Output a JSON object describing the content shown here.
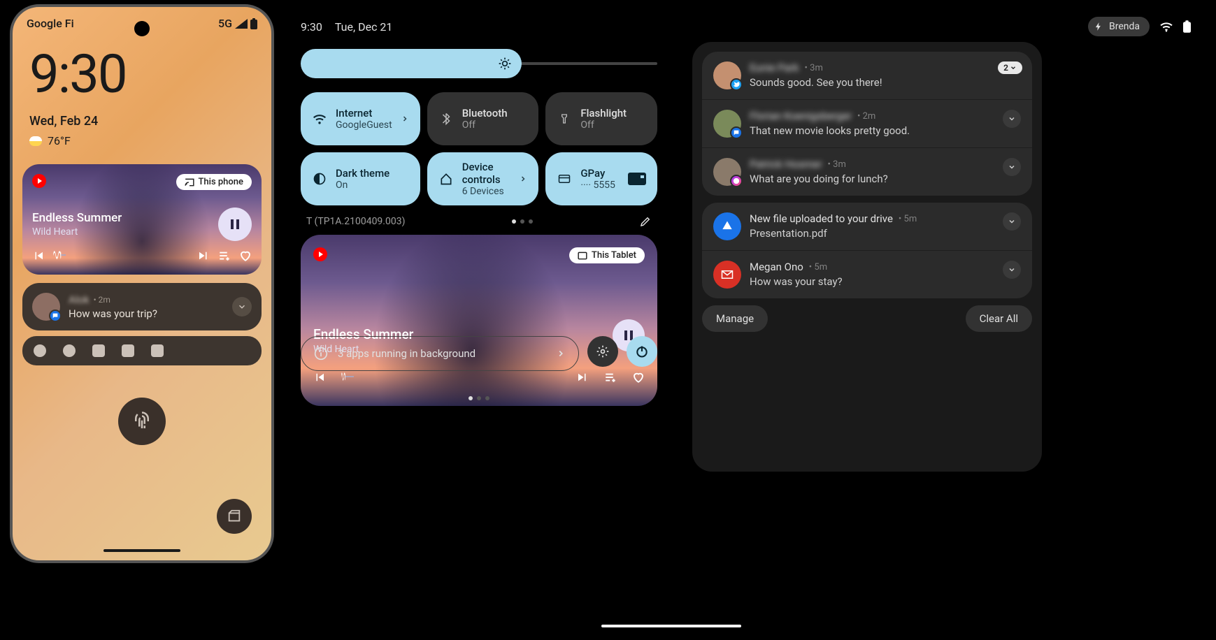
{
  "phone": {
    "carrier": "Google Fi",
    "network": "5G",
    "time": "9:30",
    "date": "Wed, Feb 24",
    "temperature": "76°F",
    "media": {
      "cast_label": "This phone",
      "title": "Endless Summer",
      "artist": "Wild Heart"
    },
    "notification": {
      "sender": "Alok",
      "time": "2m",
      "message": "How was your trip?"
    }
  },
  "tablet": {
    "time": "9:30",
    "date": "Tue, Dec 21",
    "user": "Brenda",
    "quick_settings": [
      {
        "title": "Internet",
        "subtitle": "GoogleGuest",
        "active": true,
        "chevron": true
      },
      {
        "title": "Bluetooth",
        "subtitle": "Off",
        "active": false
      },
      {
        "title": "Flashlight",
        "subtitle": "Off",
        "active": false
      },
      {
        "title": "Dark theme",
        "subtitle": "On",
        "active": true
      },
      {
        "title": "Device controls",
        "subtitle": "6 Devices",
        "active": true,
        "chevron": true
      },
      {
        "title": "GPay",
        "subtitle": "···· 5555",
        "active": true,
        "card": true
      }
    ],
    "build": "T (TP1A.2100409.003)",
    "media": {
      "cast_label": "This Tablet",
      "title": "Endless Summer",
      "artist": "Wild Heart"
    },
    "bg_apps": "3 apps running in background",
    "notifications": {
      "groups": [
        [
          {
            "sender": "Eunie Park",
            "time": "3m",
            "message": "Sounds good. See you there!",
            "count": "2",
            "blur": true
          },
          {
            "sender": "Florian Koenigsberger",
            "time": "2m",
            "message": "That new movie looks pretty good.",
            "blur": true
          },
          {
            "sender": "Patrick Hosmer",
            "time": "3m",
            "message": "What are you doing for lunch?",
            "blur": true
          }
        ],
        [
          {
            "sender": "New file uploaded to your drive",
            "time": "5m",
            "message": "Presentation.pdf",
            "icon": "drive"
          },
          {
            "sender": "Megan Ono",
            "time": "5m",
            "message": "How was your stay?",
            "icon": "gmail"
          }
        ]
      ],
      "manage": "Manage",
      "clear": "Clear All"
    }
  }
}
